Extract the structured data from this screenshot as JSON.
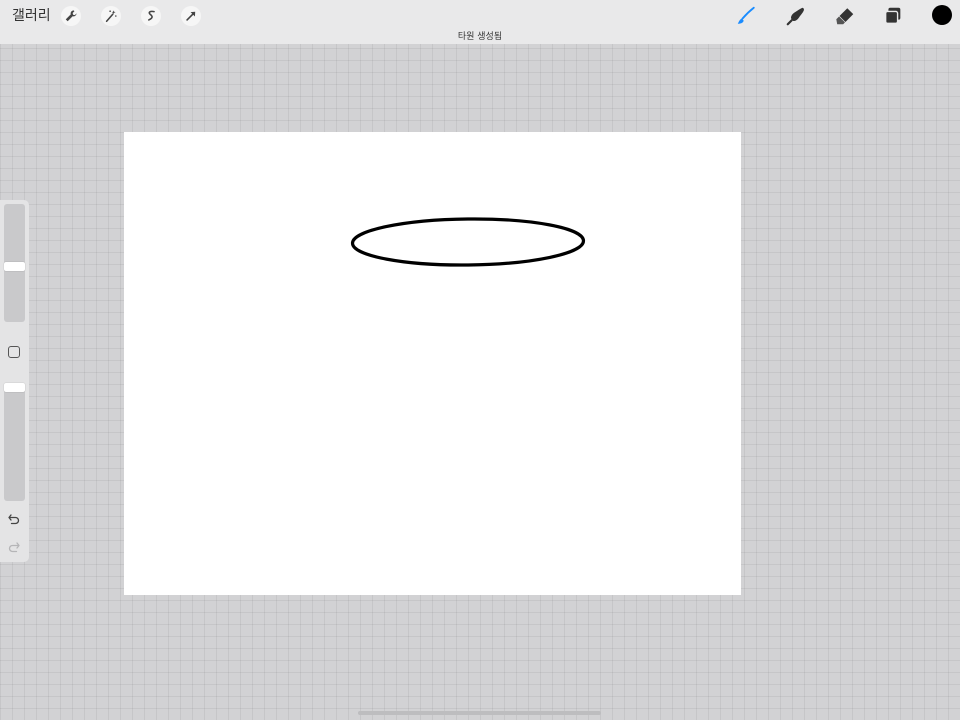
{
  "toolbar": {
    "gallery_label": "갤러리",
    "left_tools": [
      "wrench-icon",
      "magic-wand-icon",
      "selection-icon",
      "transform-arrow-icon"
    ],
    "right_tools": [
      "brush-icon",
      "smudge-icon",
      "eraser-icon",
      "layers-icon"
    ],
    "active_tool": "brush",
    "accent_color": "#1a8cff",
    "current_color": "#000000"
  },
  "notice": {
    "text": "타원 생성됨"
  },
  "canvas": {
    "background": "#ffffff",
    "drawn_shape": "ellipse",
    "stroke_color": "#000000"
  },
  "sidebar": {
    "brush_size_level": 0.52,
    "opacity_level": 0.05,
    "undo_icon": "undo-icon",
    "redo_icon": "redo-icon"
  }
}
